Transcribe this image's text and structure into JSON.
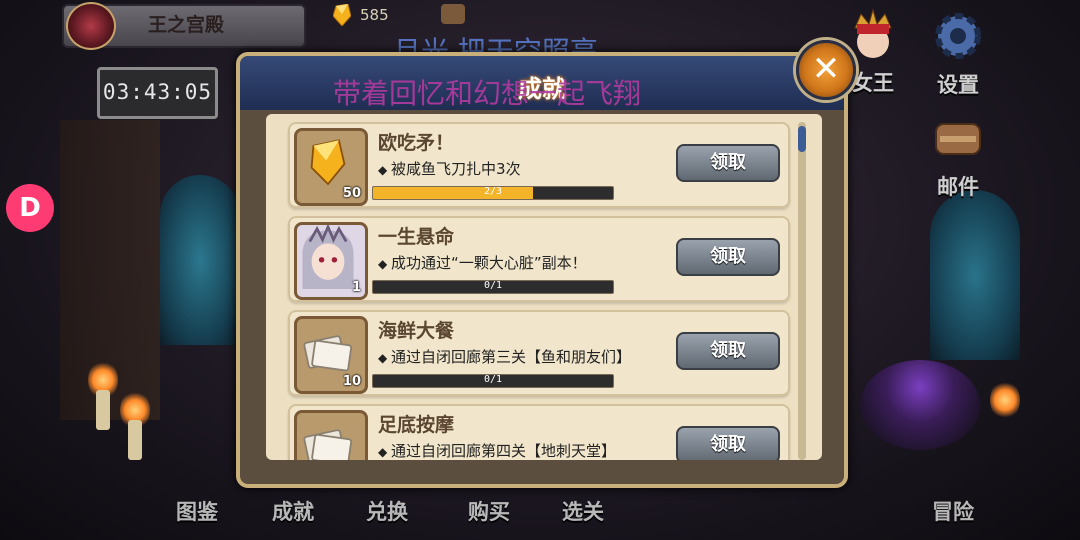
{
  "top_bar": {
    "location": "王之宫殿",
    "gem_count": "585",
    "timer": "03:43:05"
  },
  "lyrics": {
    "line1": "月光 把天空照亮",
    "line2": "带着回忆和幻想一起飞翔"
  },
  "side_menu": [
    {
      "label": "女王",
      "icon": "queen-portrait-icon"
    },
    {
      "label": "设置",
      "icon": "gear-icon"
    },
    {
      "label": "邮件",
      "icon": "mailbox-icon"
    }
  ],
  "bottom_menu": [
    {
      "label": "图鉴"
    },
    {
      "label": "成就"
    },
    {
      "label": "兑换"
    },
    {
      "label": "购买"
    },
    {
      "label": "选关"
    },
    {
      "label": "冒险"
    }
  ],
  "panel": {
    "title": "成就",
    "close_icon": "close-icon",
    "items": [
      {
        "title": "欧吃矛！",
        "desc": "被咸鱼飞刀扎中3次",
        "reward_icon": "gem-icon",
        "reward_count": "50",
        "progress_text": "2/3",
        "progress": 0.667,
        "button": "领取"
      },
      {
        "title": "一生悬命",
        "desc": "成功通过“一颗大心脏”副本！",
        "reward_icon": "character-portrait-icon",
        "reward_count": "1",
        "progress_text": "0/1",
        "progress": 0,
        "button": "领取"
      },
      {
        "title": "海鲜大餐",
        "desc": "通过自闭回廊第三关【鱼和朋友们】",
        "reward_icon": "ticket-icon",
        "reward_count": "10",
        "progress_text": "0/1",
        "progress": 0,
        "button": "领取"
      },
      {
        "title": "足底按摩",
        "desc": "通过自闭回廊第四关【地刺天堂】",
        "reward_icon": "ticket-icon",
        "reward_count": "",
        "progress_text": "",
        "progress": 0,
        "button": "领取"
      }
    ]
  },
  "colors": {
    "progress_fill": "#f4b42a",
    "header": "#2a3a64",
    "app_badge": "#ff3b74"
  }
}
